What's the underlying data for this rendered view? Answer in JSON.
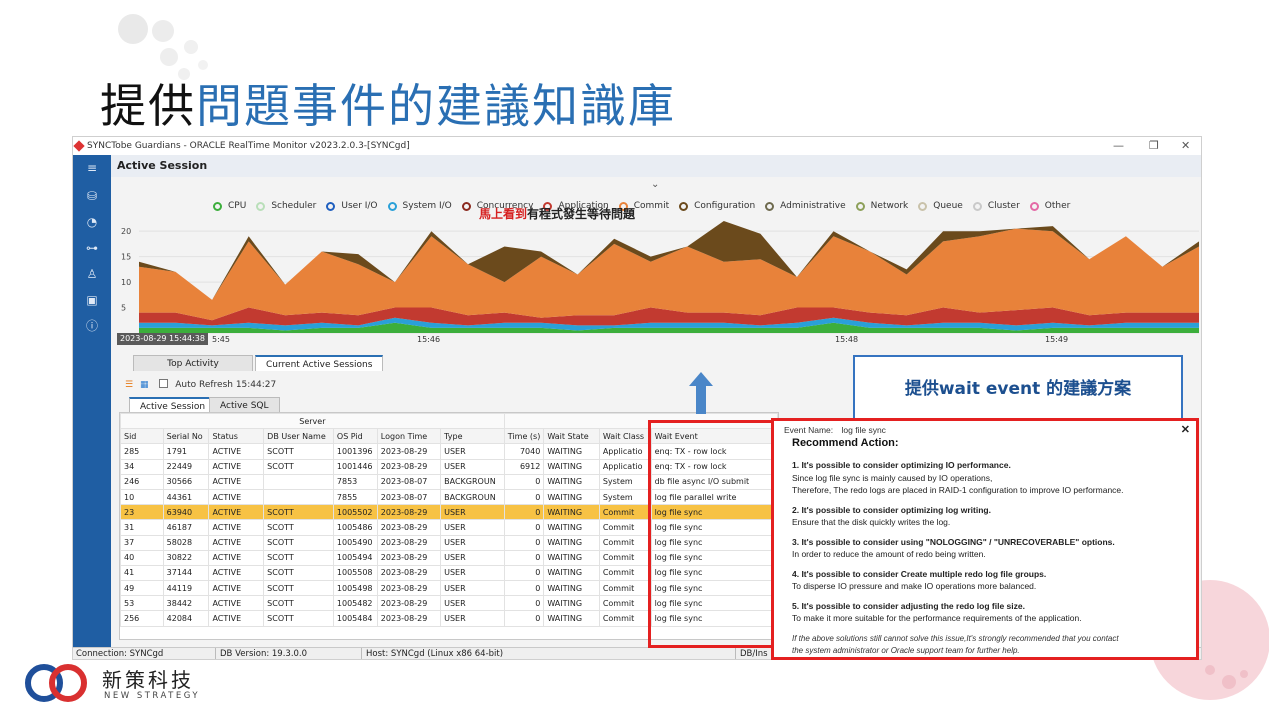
{
  "slide": {
    "title_part1": "提供",
    "title_part2": "問題事件的建議知識庫"
  },
  "window": {
    "title": "SYNCTobe Guardians - ORACLE RealTime Monitor v2023.2.0.3-[SYNCgd]",
    "panel_title": "Active Session"
  },
  "legend": [
    {
      "label": "CPU",
      "color": "#3cae3c"
    },
    {
      "label": "Scheduler",
      "color": "#b9dfb9"
    },
    {
      "label": "User I/O",
      "color": "#1f5fbf"
    },
    {
      "label": "System I/O",
      "color": "#2aa0d8"
    },
    {
      "label": "Concurrency",
      "color": "#8b2a1f"
    },
    {
      "label": "Application",
      "color": "#c23a30"
    },
    {
      "label": "Commit",
      "color": "#e8823a"
    },
    {
      "label": "Configuration",
      "color": "#6b4a1c"
    },
    {
      "label": "Administrative",
      "color": "#6e6a4e"
    },
    {
      "label": "Network",
      "color": "#8da05a"
    },
    {
      "label": "Queue",
      "color": "#c9c2aa"
    },
    {
      "label": "Cluster",
      "color": "#c9c9c9"
    },
    {
      "label": "Other",
      "color": "#e46aa6"
    }
  ],
  "chart_data": {
    "type": "area",
    "yticks": [
      "20",
      "15",
      "10",
      "5",
      "0"
    ],
    "ylim": [
      0,
      22
    ],
    "xticks": [
      "2023-08-29 15:44:38",
      "5:45",
      "15:46",
      "15:48",
      "15:49"
    ],
    "series": [
      {
        "name": "CPU",
        "values": [
          1,
          1,
          1,
          1,
          0.5,
          1,
          1,
          2,
          1,
          1,
          1,
          1,
          0.5,
          1,
          1,
          1,
          1,
          1,
          1,
          2,
          1,
          1,
          1,
          1,
          0.5,
          1,
          1,
          1,
          1,
          1
        ]
      },
      {
        "name": "System I/O",
        "values": [
          1,
          1,
          0.5,
          1,
          1,
          1,
          0.5,
          1,
          1,
          0.5,
          1,
          1,
          1,
          0.5,
          1,
          1,
          1,
          0.5,
          1,
          1,
          1,
          0.5,
          1,
          1,
          1,
          1,
          0.5,
          1,
          1,
          1
        ]
      },
      {
        "name": "Application",
        "values": [
          2,
          2,
          1,
          3,
          2,
          2,
          2,
          2,
          3,
          2,
          2,
          1,
          2,
          2,
          3,
          2,
          2,
          2,
          3,
          2,
          2,
          2,
          3,
          2,
          3,
          3,
          2,
          2,
          2,
          2
        ]
      },
      {
        "name": "Commit",
        "values": [
          9,
          8,
          4,
          13,
          6,
          12,
          10,
          5,
          14,
          10,
          6,
          12,
          8,
          14,
          9,
          13,
          10,
          11,
          6,
          14,
          12,
          8,
          13,
          15,
          16,
          15,
          11,
          15,
          9,
          13
        ]
      },
      {
        "name": "Configuration",
        "values": [
          1,
          0,
          0,
          1,
          0,
          0,
          2,
          0,
          1,
          0,
          7,
          1,
          0,
          1,
          1,
          0,
          8,
          5,
          0,
          1,
          0,
          1,
          2,
          1,
          0,
          1,
          0,
          0,
          0,
          1
        ]
      }
    ]
  },
  "tabs_top": {
    "t1": "Top Activity",
    "t2": "Current Active Sessions"
  },
  "toolbar": {
    "auto_refresh": "Auto Refresh 15:44:27"
  },
  "tabs_inner": {
    "t1": "Active Session",
    "t2": "Active SQL"
  },
  "hint": {
    "red": "馬上看到",
    "black": "有程式發生等待問題"
  },
  "table": {
    "group_header": "Server",
    "columns": [
      "Sid",
      "Serial No",
      "Status",
      "DB User Name",
      "OS Pid",
      "Logon Time",
      "Type",
      "Time (s)",
      "Wait State",
      "Wait Class",
      "Wait Event"
    ],
    "rows": [
      [
        "285",
        "1791",
        "ACTIVE",
        "SCOTT",
        "1001396",
        "2023-08-29",
        "USER",
        "7040",
        "WAITING",
        "Applicatio",
        "enq: TX - row lock"
      ],
      [
        "34",
        "22449",
        "ACTIVE",
        "SCOTT",
        "1001446",
        "2023-08-29",
        "USER",
        "6912",
        "WAITING",
        "Applicatio",
        "enq: TX - row lock"
      ],
      [
        "246",
        "30566",
        "ACTIVE",
        "",
        "7853",
        "2023-08-07",
        "BACKGROUN",
        "0",
        "WAITING",
        "System",
        "db file async I/O submit"
      ],
      [
        "10",
        "44361",
        "ACTIVE",
        "",
        "7855",
        "2023-08-07",
        "BACKGROUN",
        "0",
        "WAITING",
        "System",
        "log file parallel write"
      ],
      [
        "23",
        "63940",
        "ACTIVE",
        "SCOTT",
        "1005502",
        "2023-08-29",
        "USER",
        "0",
        "WAITING",
        "Commit",
        "log file sync"
      ],
      [
        "31",
        "46187",
        "ACTIVE",
        "SCOTT",
        "1005486",
        "2023-08-29",
        "USER",
        "0",
        "WAITING",
        "Commit",
        "log file sync"
      ],
      [
        "37",
        "58028",
        "ACTIVE",
        "SCOTT",
        "1005490",
        "2023-08-29",
        "USER",
        "0",
        "WAITING",
        "Commit",
        "log file sync"
      ],
      [
        "40",
        "30822",
        "ACTIVE",
        "SCOTT",
        "1005494",
        "2023-08-29",
        "USER",
        "0",
        "WAITING",
        "Commit",
        "log file sync"
      ],
      [
        "41",
        "37144",
        "ACTIVE",
        "SCOTT",
        "1005508",
        "2023-08-29",
        "USER",
        "0",
        "WAITING",
        "Commit",
        "log file sync"
      ],
      [
        "49",
        "44119",
        "ACTIVE",
        "SCOTT",
        "1005498",
        "2023-08-29",
        "USER",
        "0",
        "WAITING",
        "Commit",
        "log file sync"
      ],
      [
        "53",
        "38442",
        "ACTIVE",
        "SCOTT",
        "1005482",
        "2023-08-29",
        "USER",
        "0",
        "WAITING",
        "Commit",
        "log file sync"
      ],
      [
        "256",
        "42084",
        "ACTIVE",
        "SCOTT",
        "1005484",
        "2023-08-29",
        "USER",
        "0",
        "WAITING",
        "Commit",
        "log file sync"
      ]
    ],
    "selected_row": 4
  },
  "status": {
    "connection": "Connection: SYNCgd",
    "db_version": "DB Version: 19.3.0.0",
    "host": "Host: SYNCgd (Linux x86 64-bit)",
    "db_ins": "DB/Ins"
  },
  "callout": {
    "text": "提供wait event 的建議方案"
  },
  "advice": {
    "event_label": "Event Name:",
    "event_name": "log file sync",
    "title": "Recommend Action:",
    "items": [
      {
        "head": "1. It's possible to consider optimizing IO performance.",
        "body1": "Since log file sync is mainly caused by IO operations,",
        "body2": "Therefore, The redo logs are placed in RAID-1 configuration to improve IO performance."
      },
      {
        "head": "2. It's possible to consider optimizing log writing.",
        "body1": "Ensure that the disk quickly writes the log.",
        "body2": ""
      },
      {
        "head": "3. It's possible to consider using \"NOLOGGING\" / \"UNRECOVERABLE\" options.",
        "body1": "In order to reduce the amount of redo being written.",
        "body2": ""
      },
      {
        "head": "4. It's possible to consider Create multiple redo log file groups.",
        "body1": "To disperse IO pressure and make IO operations more balanced.",
        "body2": ""
      },
      {
        "head": "5. It's possible to consider adjusting the redo log file size.",
        "body1": "To make it more suitable for the performance requirements of the application.",
        "body2": ""
      }
    ],
    "note1": "If the above solutions still cannot solve this issue,It's strongly recommended that you contact",
    "note2": "the system administrator or Oracle support team for further help."
  },
  "logo": {
    "cn": "新策科技",
    "en": "NEW STRATEGY"
  }
}
